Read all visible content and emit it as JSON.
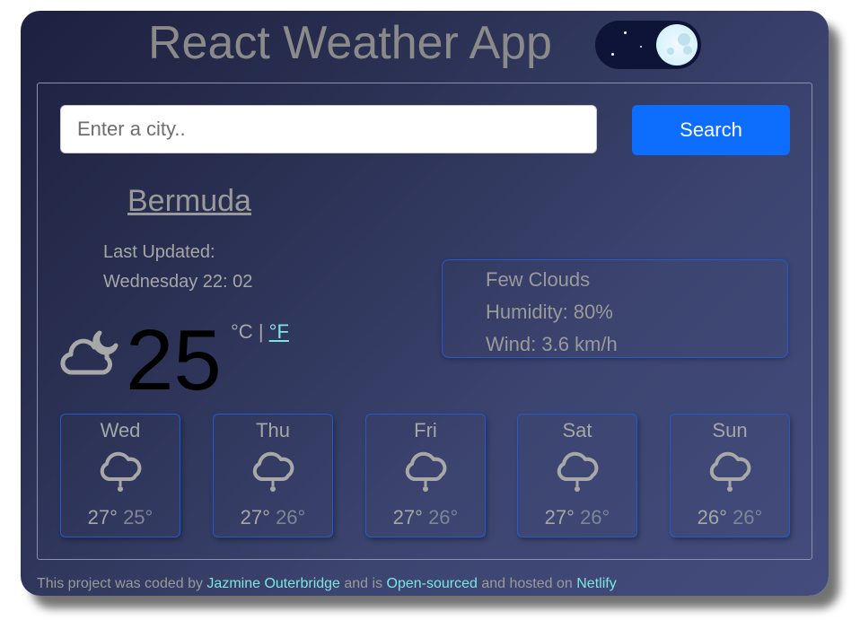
{
  "header": {
    "title": "React Weather App",
    "theme_toggle": {
      "state": "dark",
      "icon": "moon-icon"
    }
  },
  "search": {
    "placeholder": "Enter a city..",
    "value": "",
    "button_label": "Search"
  },
  "current": {
    "city": "Bermuda",
    "last_updated_label": "Last Updated:",
    "last_updated_value": "Wednesday 22: 02",
    "icon": "cloudy-night-icon",
    "temperature": "25",
    "unit_celsius": "°C",
    "unit_separator": "|",
    "unit_fahrenheit": "°F",
    "description": "Few Clouds",
    "humidity": "Humidity: 80%",
    "wind": "Wind: 3.6 km/h"
  },
  "forecast": [
    {
      "day": "Wed",
      "icon": "rain-cloud-icon",
      "max": "27°",
      "min": "25°"
    },
    {
      "day": "Thu",
      "icon": "rain-cloud-icon",
      "max": "27°",
      "min": "26°"
    },
    {
      "day": "Fri",
      "icon": "rain-cloud-icon",
      "max": "27°",
      "min": "26°"
    },
    {
      "day": "Sat",
      "icon": "rain-cloud-icon",
      "max": "27°",
      "min": "26°"
    },
    {
      "day": "Sun",
      "icon": "rain-cloud-icon",
      "max": "26°",
      "min": "26°"
    }
  ],
  "footer": {
    "text1": "This project was coded by ",
    "author_link": "Jazmine Outerbridge",
    "text2": " and is ",
    "source_link": "Open-sourced",
    "text3": " and hosted on ",
    "host_link": "Netlify"
  },
  "colors": {
    "accent": "#0d6efd",
    "link": "#7be6e0",
    "card_border": "#1e5ccf"
  }
}
